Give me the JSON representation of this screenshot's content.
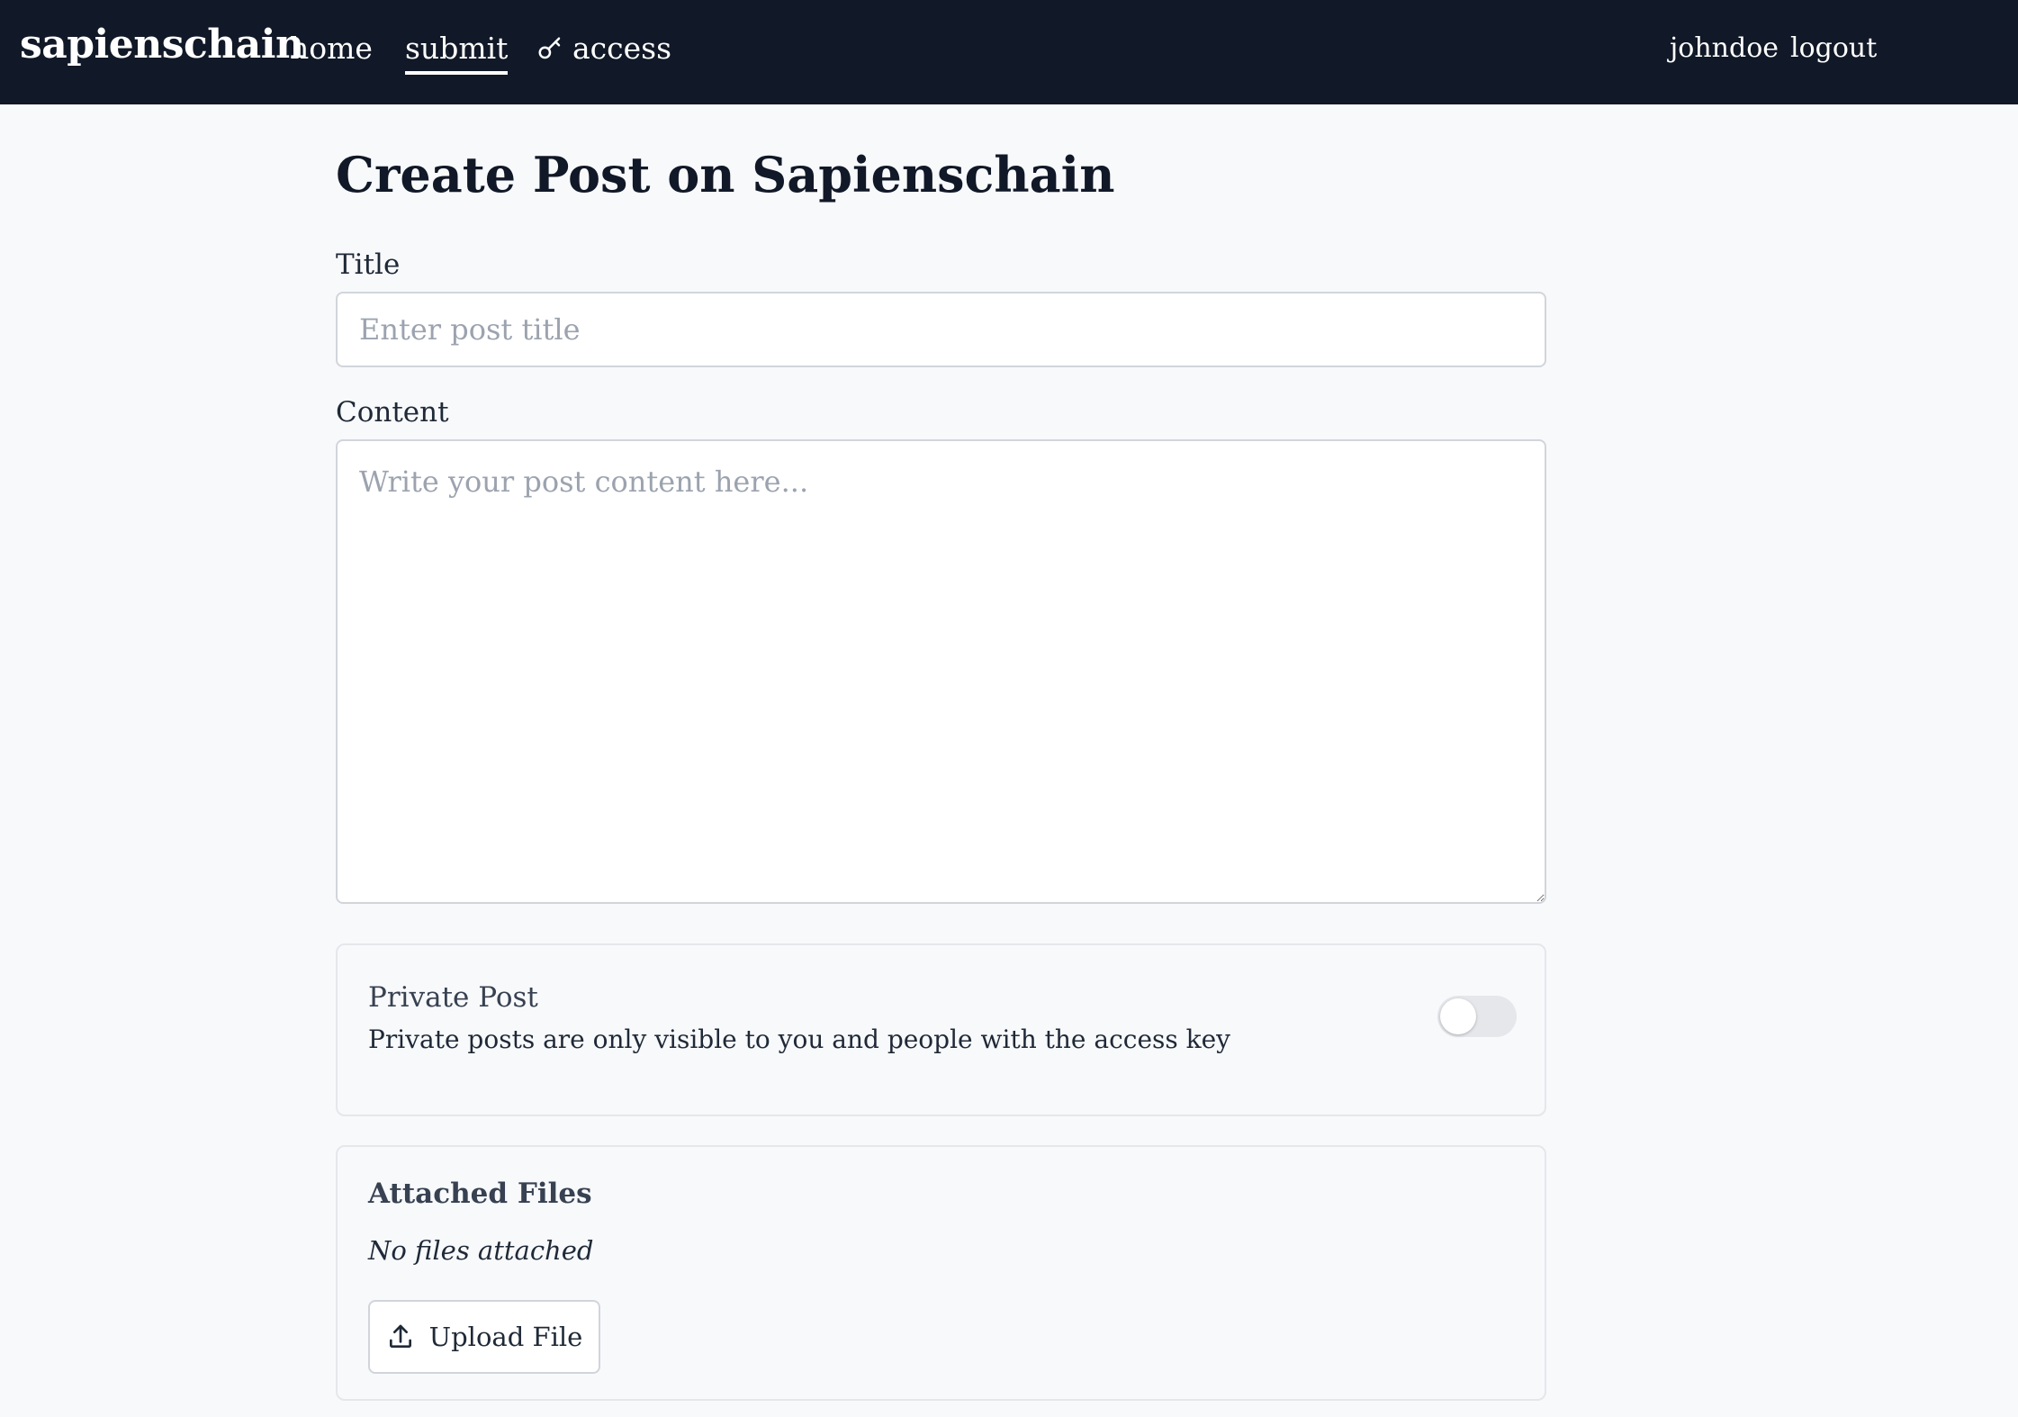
{
  "navbar": {
    "brand": "sapienschain",
    "links": [
      {
        "label": "home"
      },
      {
        "label": "submit",
        "active": true
      },
      {
        "label": "access",
        "icon": "key-icon"
      }
    ],
    "user": "johndoe",
    "logout": "logout"
  },
  "page": {
    "title": "Create Post on Sapienschain"
  },
  "form": {
    "title_label": "Title",
    "title_placeholder": "Enter post title",
    "title_value": "",
    "content_label": "Content",
    "content_placeholder": "Write your post content here...",
    "content_value": ""
  },
  "private_post": {
    "title": "Private Post",
    "description": "Private posts are only visible to you and people with the access key",
    "enabled": false
  },
  "attachments": {
    "title": "Attached Files",
    "empty_text": "No files attached",
    "upload_label": "Upload File",
    "upload_icon": "upload-icon"
  },
  "colors": {
    "navbar_bg": "#111827",
    "page_bg": "#f8f9fb",
    "border": "#d1d5db",
    "toggle_off": "#e5e7eb"
  }
}
